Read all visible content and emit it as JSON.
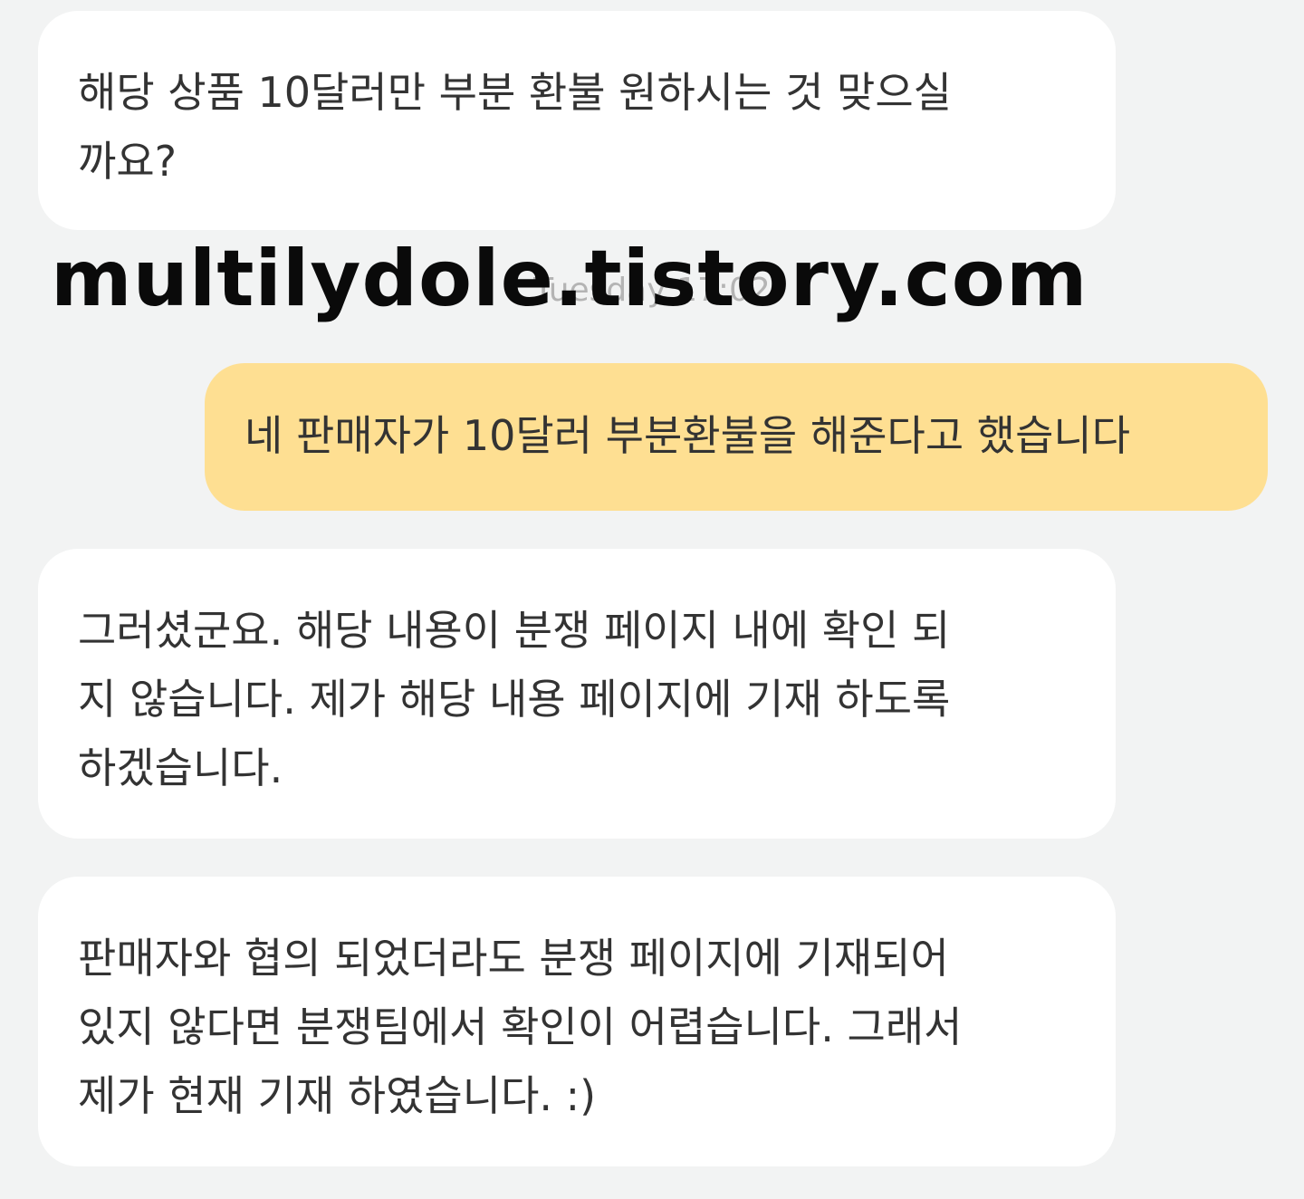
{
  "messages": [
    {
      "sender": "agent",
      "lines": [
        "해당 상품 10달러만 부분 환불 원하시는 것 맞으실",
        "까요?"
      ]
    },
    {
      "timestamp": "Tuesday 17:02"
    },
    {
      "sender": "user",
      "lines": [
        "네 판매자가 10달러 부분환불을 해준다고 했습니다"
      ]
    },
    {
      "sender": "agent",
      "lines": [
        "그러셨군요. 해당 내용이 분쟁 페이지 내에 확인 되",
        "지 않습니다. 제가 해당 내용 페이지에 기재 하도록",
        "하겠습니다."
      ]
    },
    {
      "sender": "agent",
      "lines": [
        "판매자와 협의 되었더라도 분쟁 페이지에 기재되어",
        "있지 않다면 분쟁팀에서 확인이 어렵습니다. 그래서",
        "제가 현재 기재 하였습니다. :)"
      ]
    }
  ],
  "watermark": "multilydole.tistory.com",
  "colors": {
    "background": "#f2f3f3",
    "incoming_bubble": "#ffffff",
    "outgoing_bubble": "#fedf92",
    "text": "#333333",
    "timestamp": "#b4b4b4"
  }
}
